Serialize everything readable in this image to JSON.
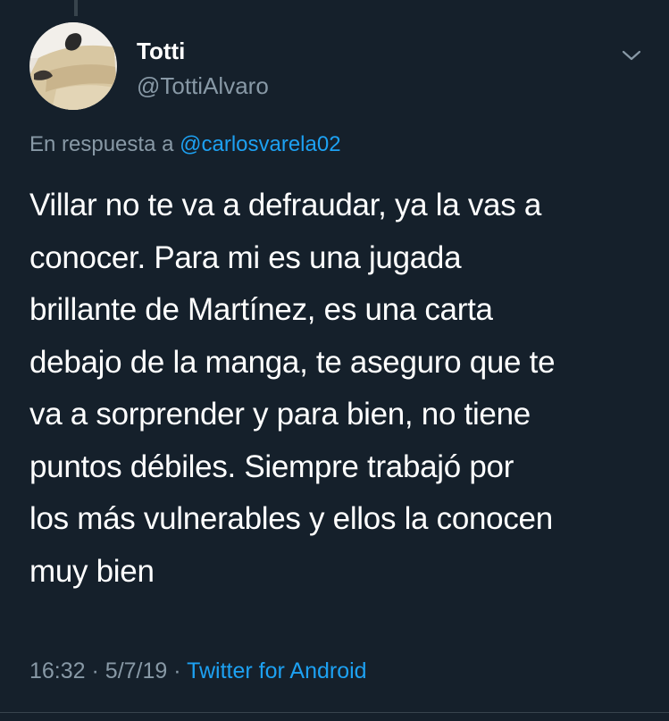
{
  "tweet": {
    "author": {
      "display_name": "Totti",
      "handle": "@TottiAlvaro"
    },
    "reply_prefix": "En respuesta a",
    "reply_to": "@carlosvarela02",
    "text": "Villar no te va a defraudar, ya la vas a\nconocer.  Para mi es una jugada\nbrillante de Martínez, es una carta\ndebajo de la manga, te aseguro que te\nva a sorprender y para bien, no tiene\npuntos débiles.  Siempre trabajó por\nlos más vulnerables y ellos la conocen\nmuy bien",
    "time": "16:32",
    "separator": "·",
    "date": "5/7/19",
    "source": "Twitter for Android"
  },
  "icons": {
    "menu": "chevron-down-icon",
    "avatar": "profile-photo"
  },
  "colors": {
    "background": "#15202b",
    "text": "#ffffff",
    "secondary_text": "#8899a6",
    "link": "#1da1f2",
    "border": "#38444d"
  }
}
